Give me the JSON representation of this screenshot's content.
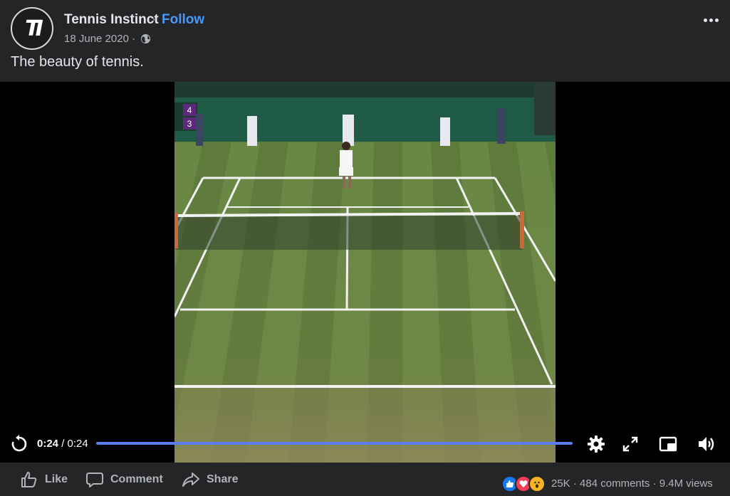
{
  "post": {
    "page_name": "Tennis Instinct",
    "separator": "·",
    "follow_label": "Follow",
    "date": "18 June 2020 ·",
    "caption": "The beauty of tennis.",
    "avatar_icon": "tennis-instinct-logo",
    "privacy_icon": "globe-icon"
  },
  "video": {
    "current_time": "0:24",
    "duration": "/ 0:24",
    "progress": 1.0,
    "scoreboard": [
      "4",
      "3"
    ]
  },
  "actions": {
    "like_label": "Like",
    "comment_label": "Comment",
    "share_label": "Share"
  },
  "stats": {
    "reaction_icons": [
      "like",
      "love",
      "wow"
    ],
    "reactions_count": "25K",
    "comments": "· 484 comments",
    "views": "· 9.4M views"
  },
  "colors": {
    "background": "#242526",
    "link": "#4599ff",
    "progress": "#5a7ef0"
  }
}
